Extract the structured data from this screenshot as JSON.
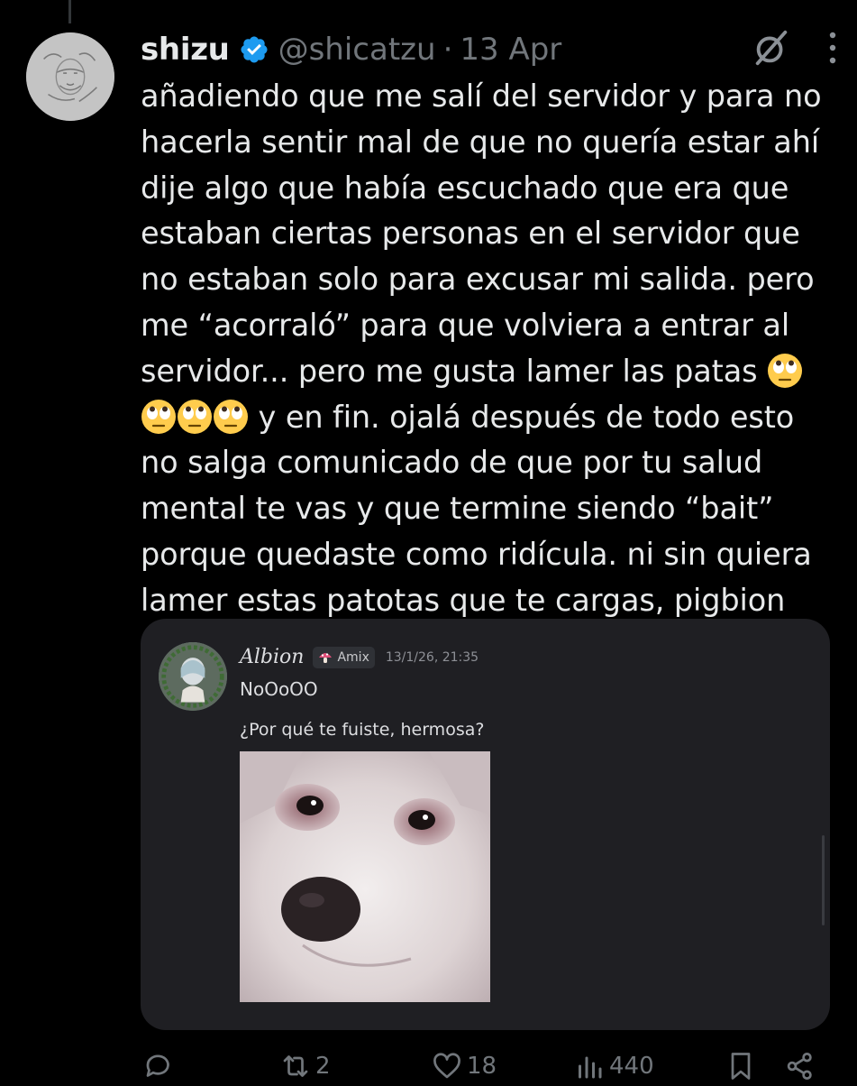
{
  "tweet": {
    "display_name": "shizu",
    "handle": "@shicatzu",
    "separator": "·",
    "date": "13 Apr",
    "text_parts": {
      "p1": "añadiendo que me salí del servidor y para no hacerla sentir mal de que no quería estar ahí dije algo que había escuchado que era que estaban ciertas personas en el servidor que no estaban solo para excusar mi salida. pero me “acorraló” para que volviera a entrar al servidor... pero me gusta lamer las patas ",
      "p2": " y en fin. ojalá después de todo esto no salga comunicado de que por tu salud mental te vas y que termine siendo “bait” porque quedaste como ridícula. ni sin quiera lamer estas patotas que te cargas, pigbion"
    },
    "emoji": "rolling-eyes-emoji"
  },
  "embedded_message": {
    "author": "Albion",
    "tag": "Amix",
    "timestamp": "13/1/26, 21:35",
    "line1": "NoOoOO",
    "line2": "¿Por qué te fuiste, hermosa?",
    "image": "crying-dog-image"
  },
  "actions": {
    "replies": "",
    "reposts": "2",
    "likes": "18",
    "views": "440"
  },
  "colors": {
    "background": "#000000",
    "text": "#e7e9ea",
    "muted": "#71767b",
    "verified": "#1d9bf0",
    "card": "#1f1f23"
  }
}
